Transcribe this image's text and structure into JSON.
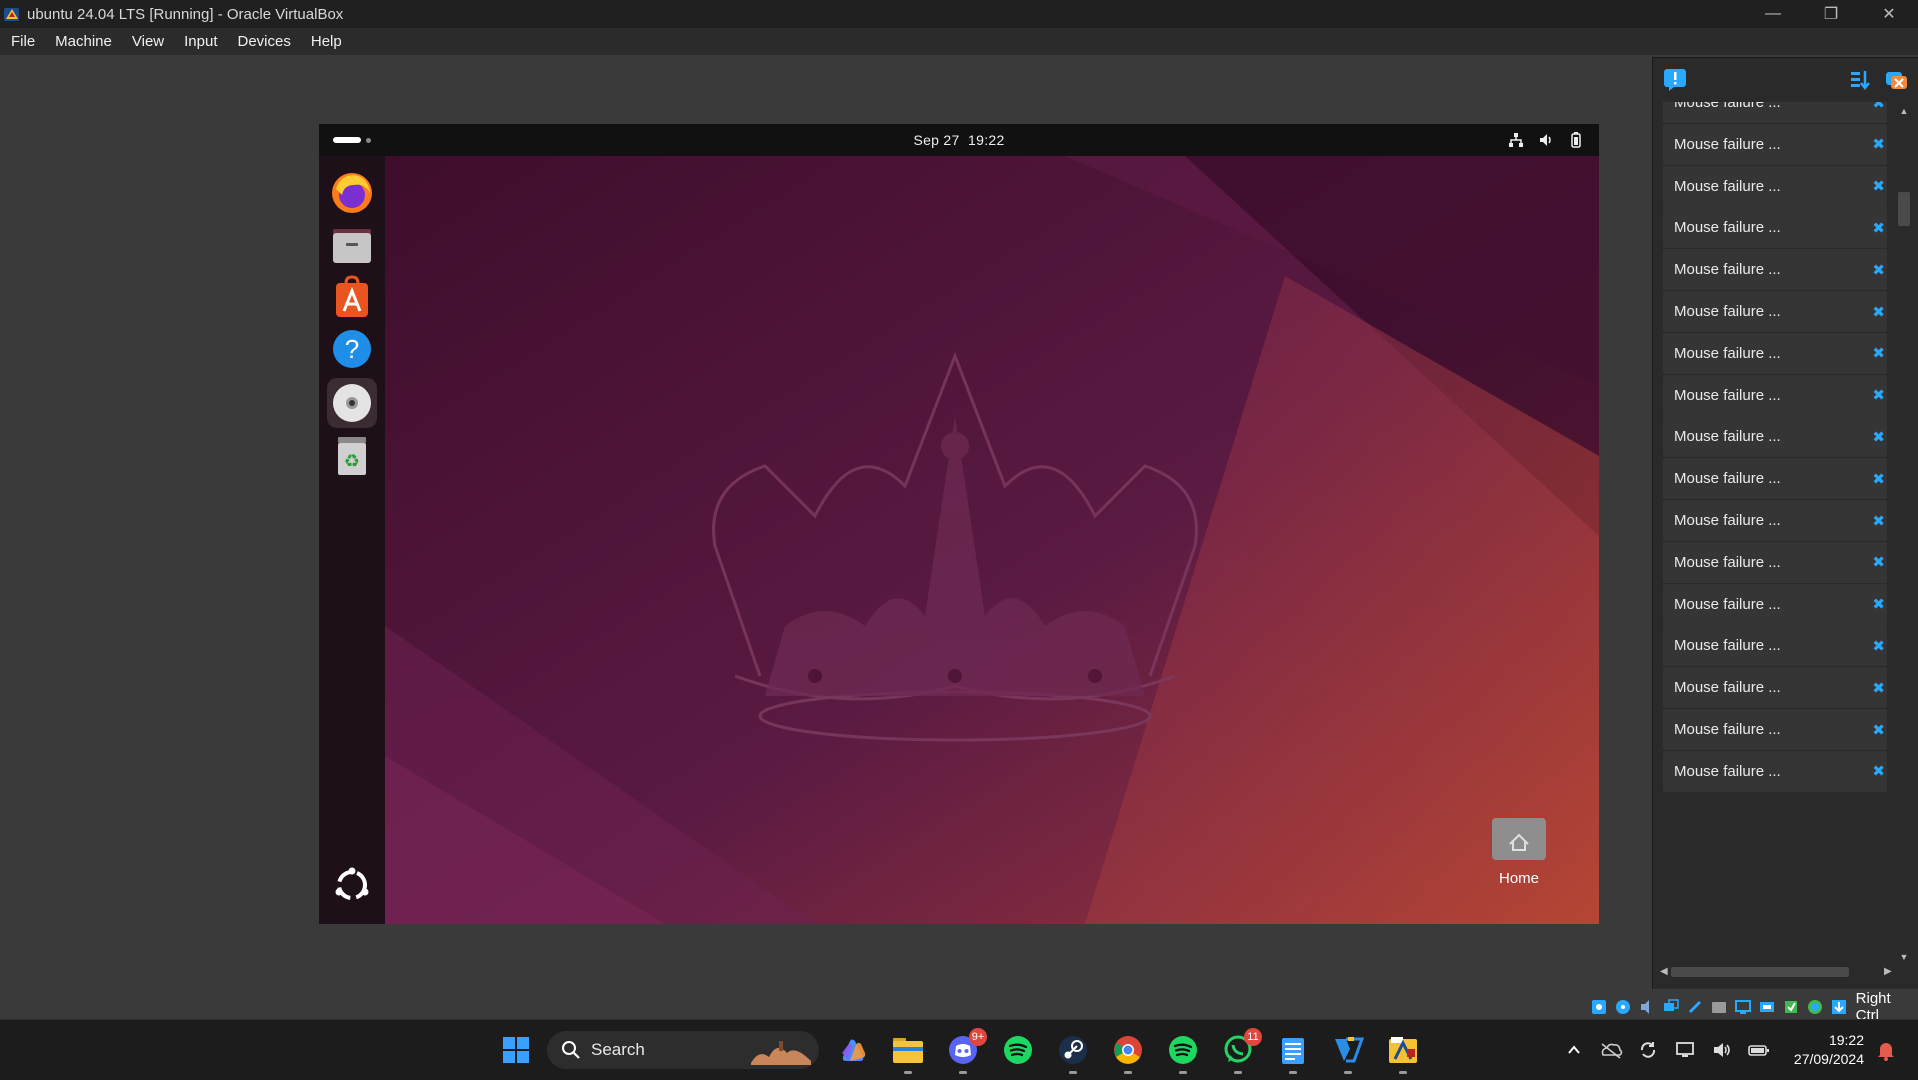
{
  "window": {
    "title": "ubuntu 24.04 LTS [Running] - Oracle VirtualBox",
    "controls": [
      "minimize-icon",
      "restore-icon",
      "close-icon"
    ]
  },
  "menu": {
    "items": [
      "File",
      "Machine",
      "View",
      "Input",
      "Devices",
      "Help"
    ]
  },
  "guest": {
    "topbar": {
      "date": "Sep 27",
      "time": "19:22"
    },
    "dock_apps": [
      "Firefox",
      "Files",
      "App Center",
      "Help",
      "Optical disc",
      "Trash"
    ],
    "desktop_icons": [
      {
        "label": "Home"
      }
    ],
    "colors": {
      "wallpaper_base": "#4b1232",
      "accent": "#e95420"
    }
  },
  "notifications": {
    "items": [
      "Mouse failure ...",
      "Mouse failure ...",
      "Mouse failure ...",
      "Mouse failure ...",
      "Mouse failure ...",
      "Mouse failure ...",
      "Mouse failure ...",
      "Mouse failure ...",
      "Mouse failure ...",
      "Mouse failure ...",
      "Mouse failure ...",
      "Mouse failure ...",
      "Mouse failure ...",
      "Mouse failure ...",
      "Mouse failure ...",
      "Mouse failure ...",
      "Mouse failure ..."
    ],
    "dismiss_color": "#29a8ff"
  },
  "statusbar": {
    "host_key": "Right Ctrl"
  },
  "taskbar": {
    "search_label": "Search",
    "discord_badge": "9+",
    "whatsapp_badge": "11",
    "clock_time": "19:22",
    "clock_date": "27/09/2024"
  }
}
